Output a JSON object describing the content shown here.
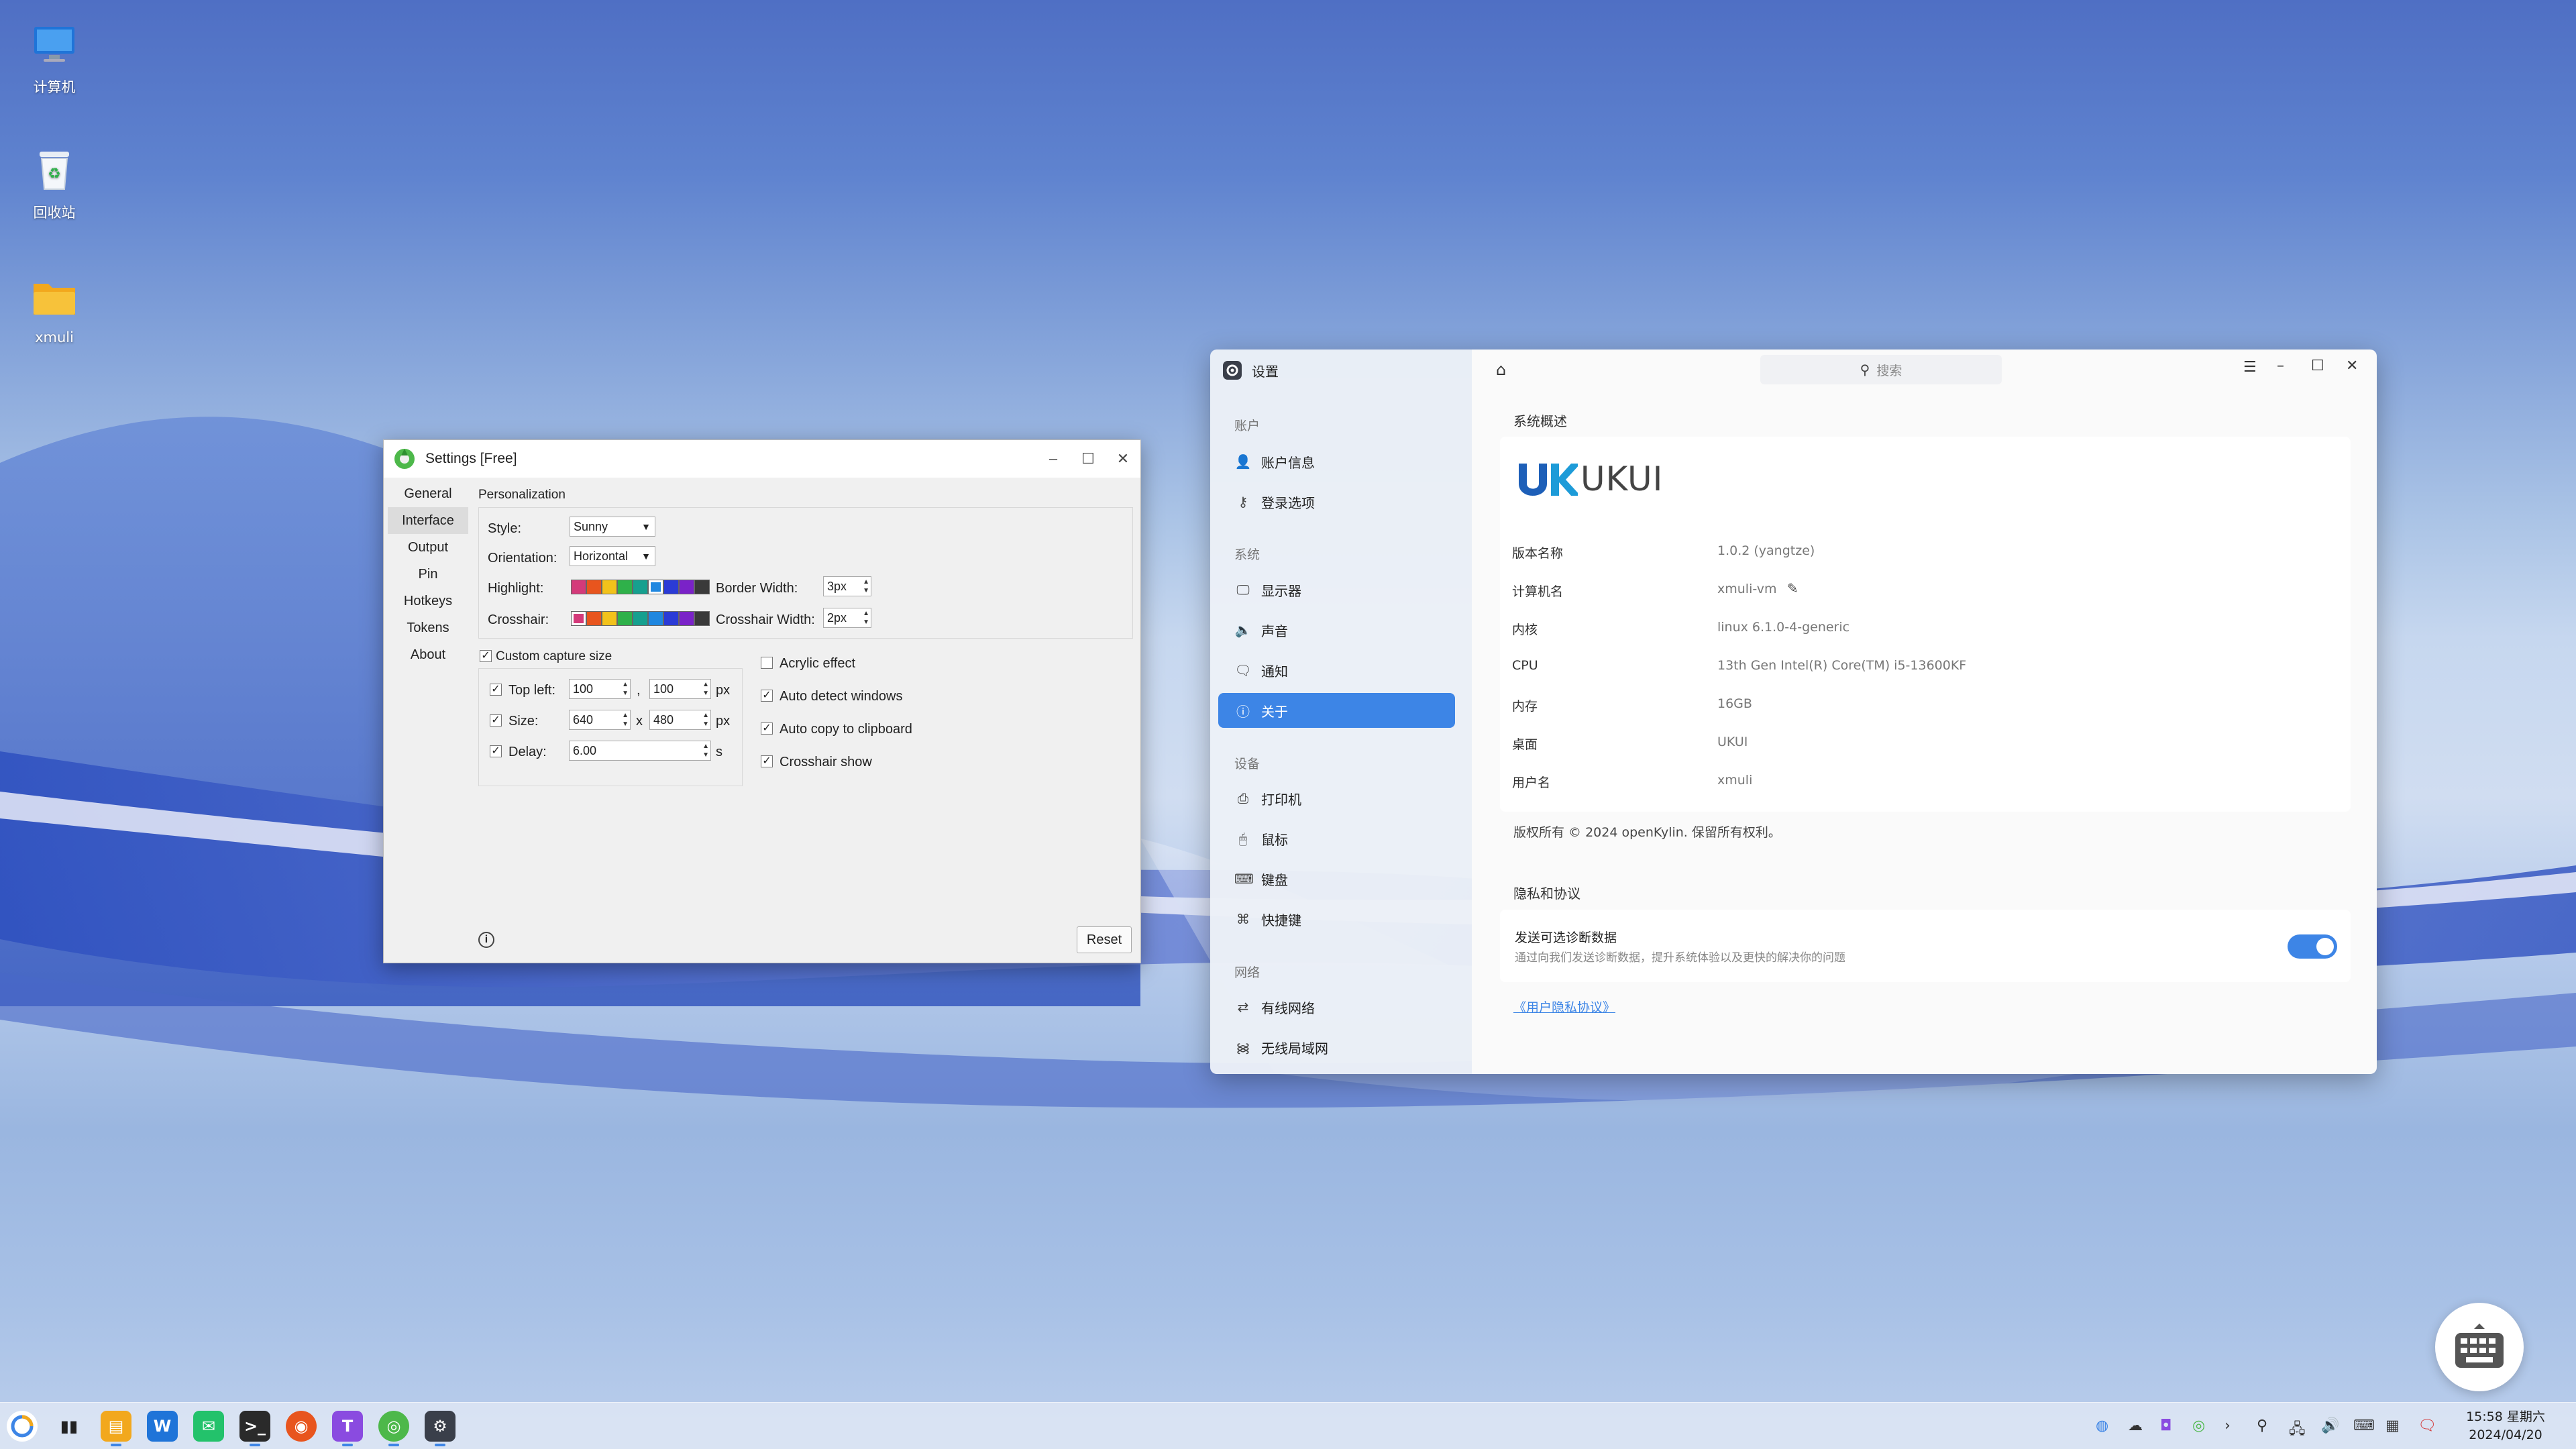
{
  "desktop": {
    "icons": [
      {
        "label": "计算机",
        "icon": "computer-icon"
      },
      {
        "label": "回收站",
        "icon": "recycle-bin-icon"
      },
      {
        "label": "xmuli",
        "icon": "folder-icon"
      }
    ]
  },
  "settings_window": {
    "title": "Settings [Free]",
    "sidebar": [
      "General",
      "Interface",
      "Output",
      "Pin",
      "Hotkeys",
      "Tokens",
      "About"
    ],
    "active_tab": "Interface",
    "personalization": {
      "header": "Personalization",
      "style_label": "Style:",
      "style_value": "Sunny",
      "orientation_label": "Orientation:",
      "orientation_value": "Horizontal",
      "highlight_label": "Highlight:",
      "crosshair_label": "Crosshair:",
      "border_width_label": "Border Width:",
      "border_width_value": "3px",
      "crosshair_width_label": "Crosshair Width:",
      "crosshair_width_value": "2px",
      "swatch_colors": [
        "#d43a7a",
        "#e8551e",
        "#f2c21b",
        "#2fb14a",
        "#16a08f",
        "#1f87e0",
        "#2b3bd6",
        "#7a22c8",
        "#3a3a3a"
      ]
    },
    "capture": {
      "custom_label": "Custom capture size",
      "custom_checked": true,
      "top_left_label": "Top left:",
      "top_left_x": "100",
      "top_left_y": "100",
      "comma": ",",
      "size_label": "Size:",
      "size_w": "640",
      "size_h": "480",
      "times": "x",
      "delay_label": "Delay:",
      "delay_value": "6.00",
      "px": "px",
      "s": "s"
    },
    "options": [
      {
        "label": "Acrylic effect",
        "checked": false
      },
      {
        "label": "Auto detect windows",
        "checked": true
      },
      {
        "label": "Auto copy to clipboard",
        "checked": true
      },
      {
        "label": "Crosshair show",
        "checked": true
      }
    ],
    "reset_label": "Reset",
    "info_icon": "info-icon"
  },
  "ukui_settings": {
    "title": "设置",
    "search_placeholder": "搜索",
    "nav_groups": [
      {
        "header": "账户",
        "items": [
          "账户信息",
          "登录选项"
        ]
      },
      {
        "header": "系统",
        "items": [
          "显示器",
          "声音",
          "通知",
          "关于"
        ]
      },
      {
        "header": "设备",
        "items": [
          "打印机",
          "鼠标",
          "键盘",
          "快捷键"
        ]
      },
      {
        "header": "网络",
        "items": [
          "有线网络",
          "无线局域网"
        ]
      }
    ],
    "active_item": "关于",
    "overview_header": "系统概述",
    "logo_text": "UKUI",
    "info": [
      {
        "key": "版本名称",
        "value": "1.0.2 (yangtze)"
      },
      {
        "key": "计算机名",
        "value": "xmuli-vm"
      },
      {
        "key": "内核",
        "value": "linux 6.1.0-4-generic"
      },
      {
        "key": "CPU",
        "value": "13th Gen Intel(R) Core(TM) i5-13600KF"
      },
      {
        "key": "内存",
        "value": "16GB"
      },
      {
        "key": "桌面",
        "value": "UKUI"
      },
      {
        "key": "用户名",
        "value": "xmuli"
      }
    ],
    "copyright": "版权所有 © 2024 openKylin. 保留所有权利。",
    "privacy_header": "隐私和协议",
    "diag_title": "发送可选诊断数据",
    "diag_desc": "通过向我们发送诊断数据，提升系统体验以及更快的解决你的问题",
    "diag_enabled": true,
    "privacy_link": "《用户隐私协议》",
    "accent": "#3d85e6"
  },
  "taskbar": {
    "time": "15:58 星期六",
    "date": "2024/04/20"
  }
}
